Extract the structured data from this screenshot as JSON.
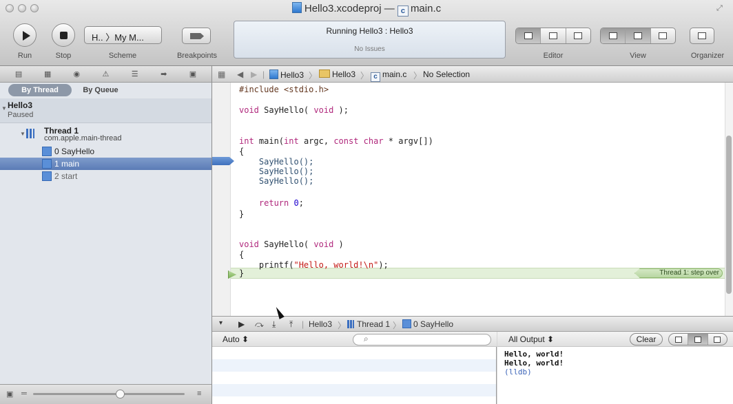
{
  "window": {
    "title_project": "Hello3.xcodeproj",
    "title_separator": "—",
    "title_file": "main.c",
    "file_badge": "c"
  },
  "toolbar": {
    "run_label": "Run",
    "stop_label": "Stop",
    "scheme_label": "Scheme",
    "scheme_value": "H.. 〉My M...",
    "breakpoints_label": "Breakpoints",
    "editor_label": "Editor",
    "view_label": "View",
    "organizer_label": "Organizer"
  },
  "status": {
    "running": "Running Hello3 : Hello3",
    "issues": "No Issues"
  },
  "navigator": {
    "tab_by_thread": "By Thread",
    "tab_by_queue": "By Queue",
    "process_name": "Hello3",
    "process_state": "Paused",
    "thread_name": "Thread 1",
    "thread_queue": "com.apple.main-thread",
    "frames": [
      "0 SayHello",
      "1 main",
      "2 start"
    ]
  },
  "jump_bar": {
    "project": "Hello3",
    "group": "Hello3",
    "file": "main.c",
    "file_badge": "c",
    "selection": "No Selection"
  },
  "code": {
    "l1": "#include <stdio.h>",
    "l2_a": "void",
    "l2_b": " SayHello( ",
    "l2_c": "void",
    "l2_d": " );",
    "l3_a": "int",
    "l3_b": " main(",
    "l3_c": "int",
    "l3_d": " argc, ",
    "l3_e": "const char",
    "l3_f": " * argv[])",
    "l4": "{",
    "l5": "    SayHello();",
    "l6": "    SayHello();",
    "l7": "    SayHello();",
    "l8_a": "    ",
    "l8_b": "return",
    "l8_c": " ",
    "l8_d": "0",
    "l8_e": ";",
    "l9": "}",
    "l10_a": "void",
    "l10_b": " SayHello( ",
    "l10_c": "void",
    "l10_d": " )",
    "l11": "{",
    "l12_a": "    printf(",
    "l12_b": "\"Hello, world!\\n\"",
    "l12_c": ");",
    "l13": "}",
    "step_badge": "Thread 1: step over"
  },
  "debug_bar": {
    "crumb_process": "Hello3",
    "crumb_thread": "Thread 1",
    "crumb_frame": "0 SayHello"
  },
  "variables": {
    "scope": "Auto ⬍",
    "search_placeholder": ""
  },
  "console": {
    "scope": "All Output ⬍",
    "clear_label": "Clear",
    "lines": [
      "Hello, world!",
      "Hello, world!",
      "(lldb)"
    ]
  },
  "colors": {
    "selection": "#5b7cb6",
    "step_highlight": "#e3f0d9",
    "keyword": "#b0287c",
    "string": "#c41a16"
  }
}
